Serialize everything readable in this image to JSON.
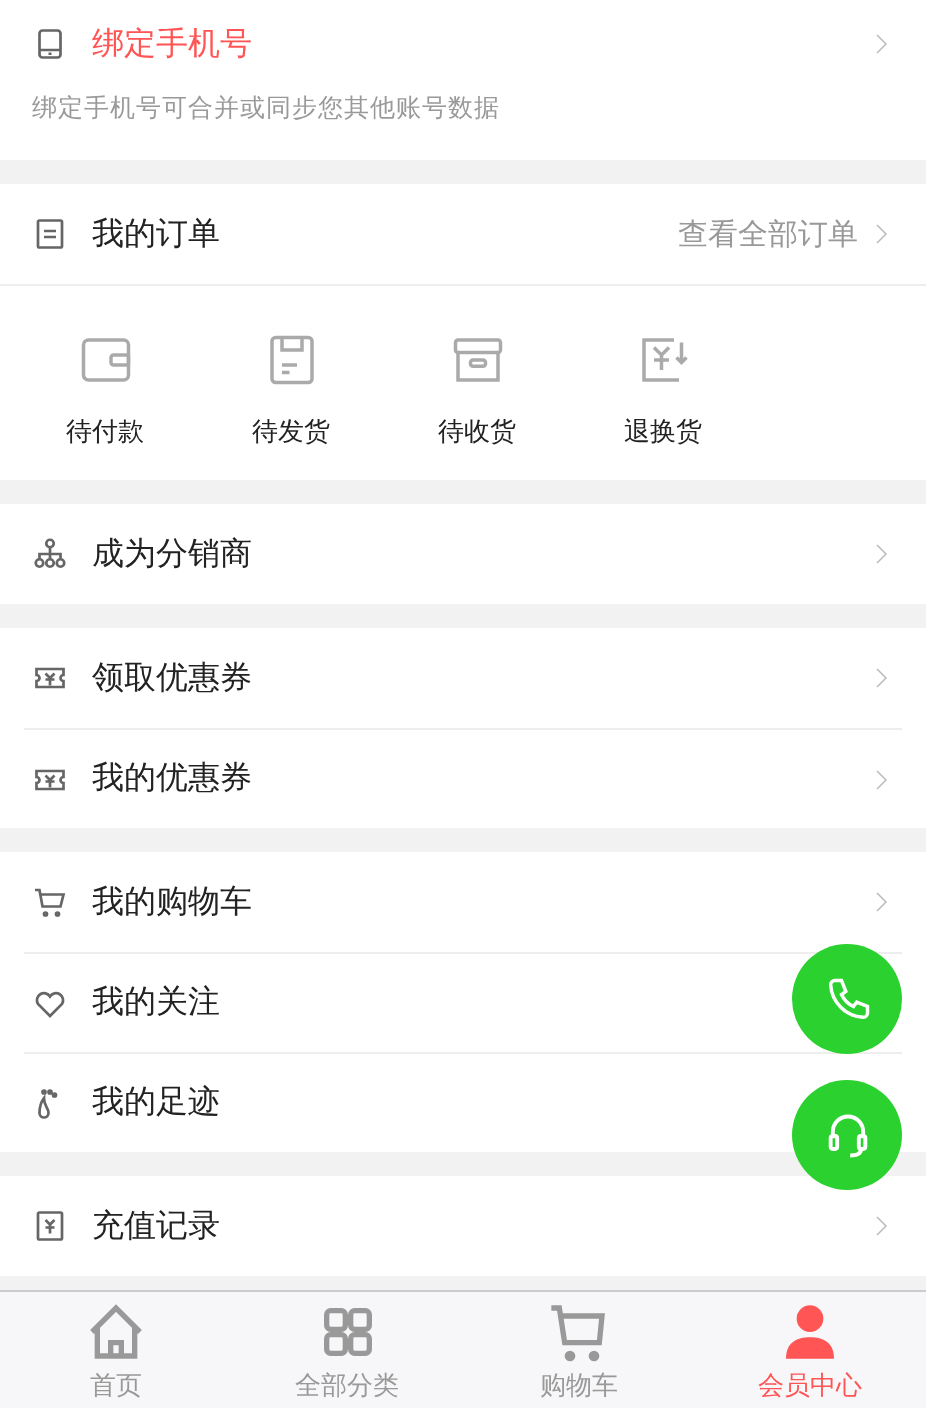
{
  "bind_phone": {
    "title": "绑定手机号",
    "subtitle": "绑定手机号可合并或同步您其他账号数据"
  },
  "orders": {
    "title": "我的订单",
    "link": "查看全部订单",
    "statuses": [
      {
        "label": "待付款"
      },
      {
        "label": "待发货"
      },
      {
        "label": "待收货"
      },
      {
        "label": "退换货"
      }
    ]
  },
  "sections": [
    [
      {
        "label": "成为分销商",
        "chevron": true
      }
    ],
    [
      {
        "label": "领取优惠券",
        "chevron": true
      },
      {
        "label": "我的优惠券",
        "chevron": true
      }
    ],
    [
      {
        "label": "我的购物车",
        "chevron": true
      },
      {
        "label": "我的关注",
        "chevron": false
      },
      {
        "label": "我的足迹",
        "chevron": false
      }
    ],
    [
      {
        "label": "充值记录",
        "chevron": true
      }
    ]
  ],
  "tab_bar": [
    {
      "label": "首页",
      "selected": false
    },
    {
      "label": "全部分类",
      "selected": false
    },
    {
      "label": "购物车",
      "selected": false
    },
    {
      "label": "会员中心",
      "selected": true
    }
  ]
}
